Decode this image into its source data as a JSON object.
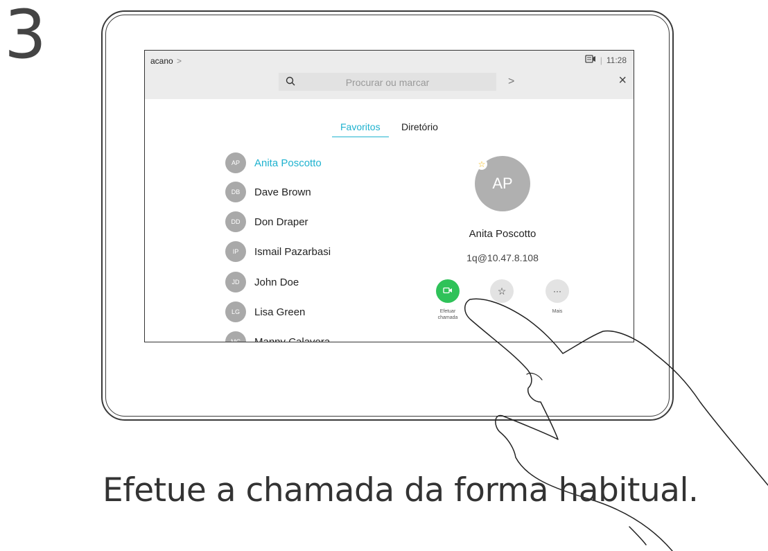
{
  "step": "3",
  "caption": "Efetue a chamada da forma habitual.",
  "app": {
    "brand": "acano",
    "brand_chevron": ">",
    "time": "11:28",
    "status_separator": "|"
  },
  "search": {
    "placeholder": "Procurar ou marcar",
    "go": ">",
    "close": "×"
  },
  "tabs": [
    {
      "label": "Favoritos",
      "active": true
    },
    {
      "label": "Diretório",
      "active": false
    }
  ],
  "contacts": [
    {
      "initials": "AP",
      "name": "Anita Poscotto",
      "active": true
    },
    {
      "initials": "DB",
      "name": "Dave Brown"
    },
    {
      "initials": "DD",
      "name": "Don Draper"
    },
    {
      "initials": "IP",
      "name": "Ismail Pazarbasi"
    },
    {
      "initials": "JD",
      "name": "John Doe"
    },
    {
      "initials": "LG",
      "name": "Lisa Green"
    },
    {
      "initials": "MC",
      "name": "Manny Calavera"
    }
  ],
  "detail": {
    "initials": "AP",
    "name": "Anita Poscotto",
    "address": "1q@10.47.8.108",
    "favorite_badge": "☆",
    "actions": {
      "call_label_1": "Efetuar",
      "call_label_2": "chamada",
      "favorite_glyph": "☆",
      "more_glyph": "···",
      "more_label": "Mais"
    }
  },
  "colors": {
    "accent": "#1eb2cf",
    "call_green": "#2fc259",
    "avatar_gray": "#a9a9a9",
    "topbar": "#ececec"
  }
}
